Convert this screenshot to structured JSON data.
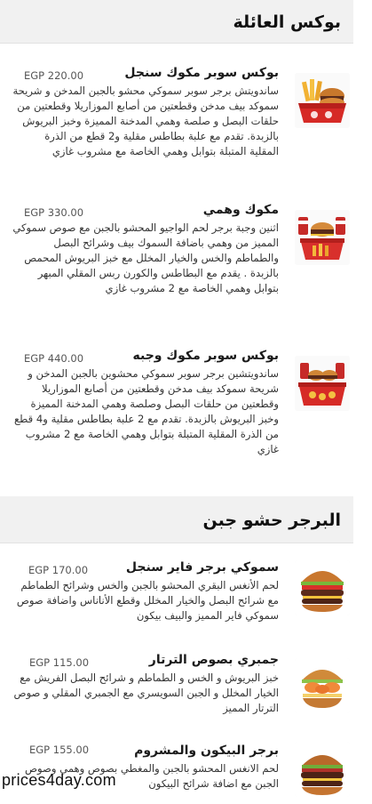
{
  "sections": [
    {
      "title": "بوكس العائلة",
      "items": [
        {
          "name": "بوكس سوبر مكوك سنجل",
          "price": "EGP 220.00",
          "description": "ساندويتش برجر سوبر سموكي محشو بالجبن المدخن و شريحة سموكد بيف مدخن وقطعتين من أصابع الموزاريلا وقطعتين من حلقات البصل و صلصة وهمي المدخنة المميزة وخبز البريوش بالزبدة. تقدم مع علبة بطاطس مقلية و2 قطع من الذرة المقلية المتبلة بتوابل وهمي الخاصة مع مشروب غازي",
          "image": "fries-box-icon"
        },
        {
          "name": "مكوك وهمي",
          "price": "EGP 330.00",
          "description": "اثنين وجبة برجر لحم الواجيو المحشو بالجبن مع صوص سموكي المميز من وهمي باضافة السموك بيف وشرائح البصل والطماطم والخس والخيار المخلل مع خبز البريوش المحمص بالزبدة . يقدم مع البطاطس والكورن ربس المقلي المبهر بتوابل وهمي الخاصة مع 2 مشروب غازي",
          "image": "meal-box-icon"
        },
        {
          "name": "بوكس سوبر مكوك وجبه",
          "price": "EGP 440.00",
          "description": "ساندويتشين برجر سوبر سموكي محشوين بالجبن المدخن و شريحة سموكد بيف مدخن وقطعتين من أصابع الموزاريلا وقطعتين من حلقات البصل وصلصة وهمي المدخنة المميزة وخبز البريوش بالزبدة. تقدم مع 2 علبة بطاطس مقلية و4 قطع من الذرة المقلية المتبلة بتوابل وهمي الخاصة مع 2 مشروب غازي",
          "image": "combo-box-icon"
        }
      ]
    },
    {
      "title": "البرجر حشو جبن",
      "items": [
        {
          "name": "سموكي برجر فاير سنجل",
          "price": "EGP 170.00",
          "description": "لحم الأنغس البقري المحشو بالجبن والخس وشرائح الطماطم مع شرائح البصل والخيار المخلل وقطع الأناناس واضافة صوص سموكي فاير المميز والبيف بيكون",
          "image": "burger-icon"
        },
        {
          "name": "جمبري بصوص الترتار",
          "price": "EGP 115.00",
          "description": "خبز البريوش و الخس و الطماطم و شرائح البصل الفريش مع الخيار المخلل و الجبن السويسري مع الجمبري المقلي و صوص الترتار المميز",
          "image": "shrimp-burger-icon"
        },
        {
          "name": "برجر البيكون والمشروم",
          "price": "EGP 155.00",
          "description": "لحم الانغس المحشو بالجبن والمغطي بصوص وهمي وصوص الجبن مع اضافة شرائح البيكون",
          "image": "bacon-burger-icon"
        }
      ]
    }
  ],
  "watermark": "prices4day.com"
}
